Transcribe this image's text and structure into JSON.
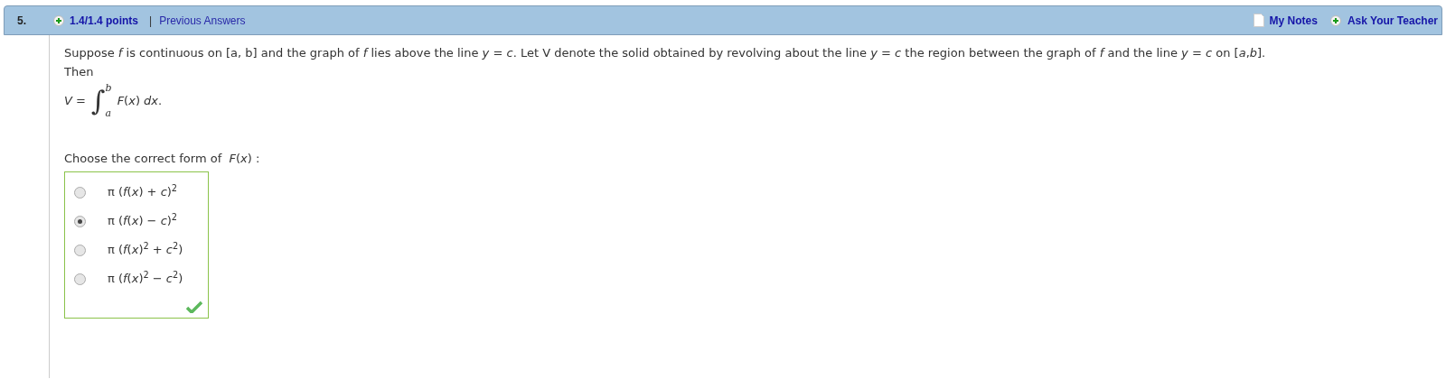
{
  "header": {
    "number": "5.",
    "points": "1.4/1.4 points",
    "separator": "|",
    "status_link": "Previous Answers",
    "notes_link": "My Notes",
    "ask_link": "Ask Your Teacher"
  },
  "question": {
    "paragraph": "Suppose *f* is continuous on [a, b] and the graph of *f* lies above the line *y* = *c*. Let V denote the solid obtained by revolving about the line *y* = *c* the region between the graph of *f* and the line *y* = *c* on [*a*,*b*].",
    "then": "Then",
    "formula": {
      "lhs": "*V* =",
      "integral_sign": "∫",
      "upper": "b",
      "lower": "a",
      "integrand": "*F*(*x*) *dx*."
    },
    "prompt": "Choose the correct form of  *F*(*x*) :"
  },
  "answers": {
    "correct": true,
    "options": [
      {
        "text": "π (*f*(*x*) + *c*)$^{2}$",
        "selected": false
      },
      {
        "text": "π (*f*(*x*) − *c*)$^{2}$",
        "selected": true
      },
      {
        "text": "π (*f*(*x*)$^{2}$ + *c*$^{2}$)",
        "selected": false
      },
      {
        "text": "π (*f*(*x*)$^{2}$ − *c*$^{2}$)",
        "selected": false
      }
    ]
  }
}
